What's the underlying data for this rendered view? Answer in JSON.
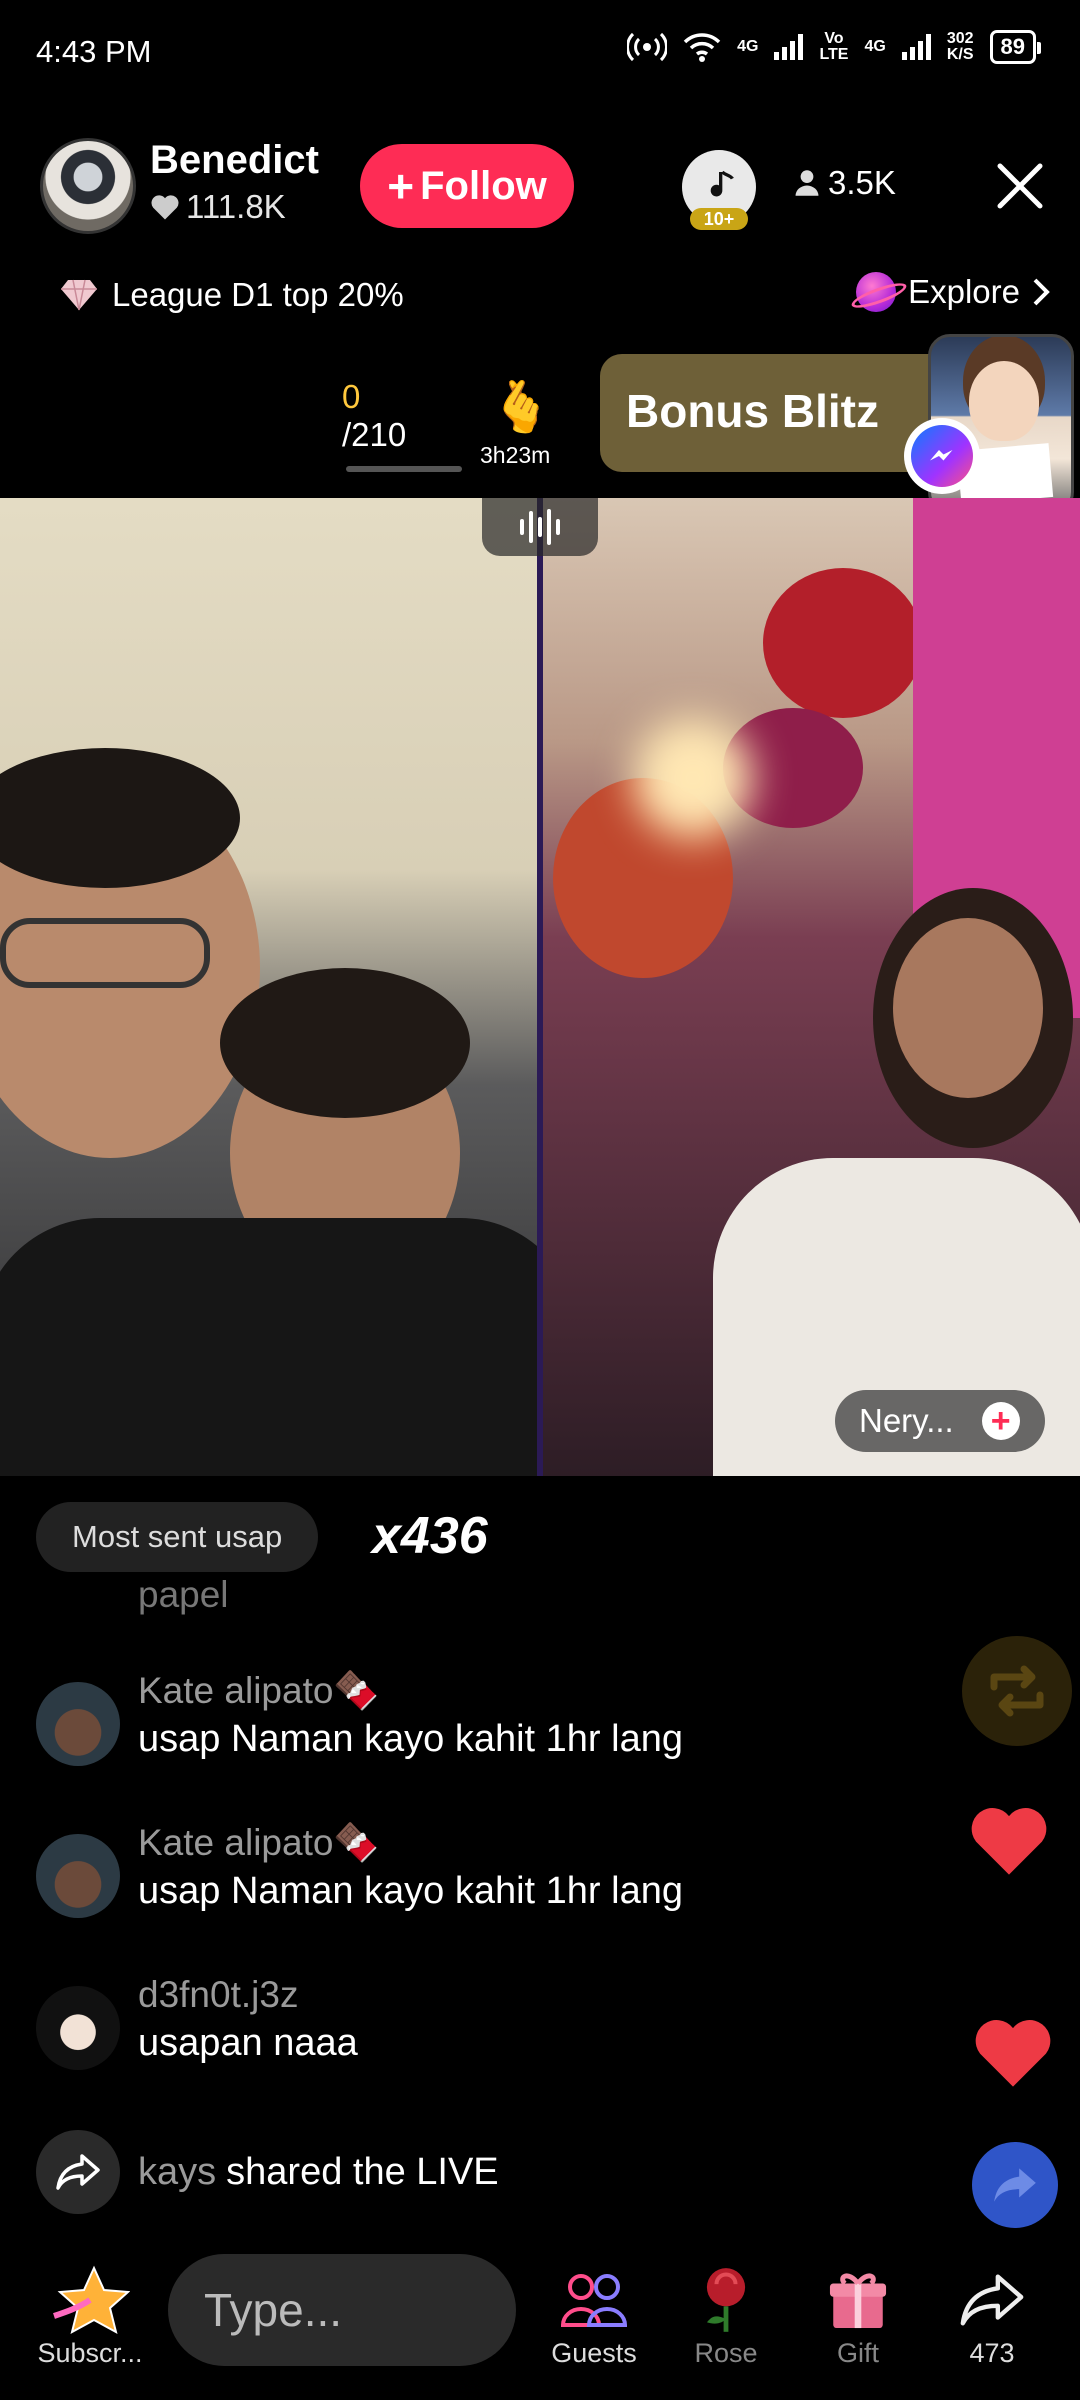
{
  "status_bar": {
    "time": "4:43 PM",
    "net_4g_1": "4G",
    "volte_top": "Vo",
    "volte_bottom": "LTE",
    "net_4g_2": "4G",
    "speed_value": "302",
    "speed_unit": "K/S",
    "battery": "89"
  },
  "header": {
    "host_name": "Benedict",
    "host_likes": "111.8K",
    "follow_label": "Follow",
    "rank_level": "10+",
    "viewer_count": "3.5K"
  },
  "league": {
    "label": "League D1 top 20%",
    "explore_label": "Explore"
  },
  "goal": {
    "current": "0",
    "total": "/210",
    "progress": 0,
    "timer": "3h23m"
  },
  "bonus": {
    "label": "Bonus Blitz"
  },
  "guest": {
    "name": "Nery..."
  },
  "chat": {
    "most_sent_label": "Most sent usap",
    "combo": "x436",
    "faded_text": "papel",
    "comments": [
      {
        "user": "Kate alipato🍫",
        "text": "usap Naman kayo kahit 1hr lang"
      },
      {
        "user": "Kate alipato🍫",
        "text": "usap Naman kayo kahit 1hr lang"
      },
      {
        "user": "d3fn0t.j3z",
        "text": "usapan naaa"
      }
    ],
    "share_user": "kays",
    "share_text": "shared the LIVE"
  },
  "bottom_bar": {
    "subscribe_label": "Subscr...",
    "input_placeholder": "Type...",
    "guests_label": "Guests",
    "rose_label": "Rose",
    "gift_label": "Gift",
    "share_count": "473"
  },
  "colors": {
    "accent": "#fe2c55",
    "goal_number": "#ffc83d",
    "bonus_bg": "#6e6038"
  },
  "icons": [
    "heart-icon",
    "person-icon",
    "close-icon",
    "diamond-icon",
    "planet-icon",
    "chevron-right-icon",
    "hand-heart-icon",
    "messenger-icon",
    "audio-wave-icon",
    "plus-icon",
    "share-arrow-icon",
    "repost-icon",
    "star-icon",
    "guests-icon",
    "rose-icon",
    "gift-icon"
  ]
}
